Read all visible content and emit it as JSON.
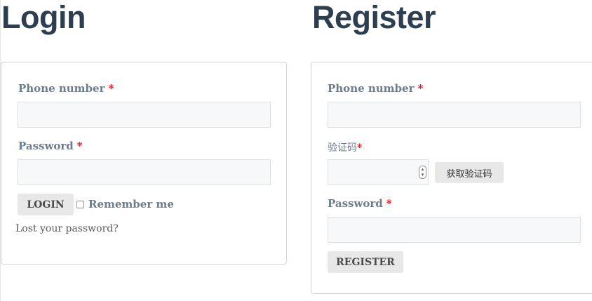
{
  "login": {
    "title": "Login",
    "phone_label": "Phone number",
    "phone_value": "",
    "password_label": "Password",
    "password_value": "",
    "required_mark": "*",
    "submit_label": "LOGIN",
    "remember_label": "Remember me",
    "remember_checked": false,
    "lost_password_link": "Lost your password?"
  },
  "register": {
    "title": "Register",
    "phone_label": "Phone number",
    "phone_value": "",
    "code_label": "验证码",
    "code_value": "",
    "get_code_label": "获取验证码",
    "password_label": "Password",
    "password_value": "",
    "required_mark": "*",
    "submit_label": "REGISTER"
  },
  "icons": {
    "spinner": "number-spinner-icon",
    "spinner_up": "▴",
    "spinner_down": "▾"
  },
  "colors": {
    "heading": "#2c3e50",
    "label": "#6d7d8c",
    "required": "#e2141b",
    "input_bg": "#f7f8fa",
    "button_bg": "#e8e8e9"
  }
}
